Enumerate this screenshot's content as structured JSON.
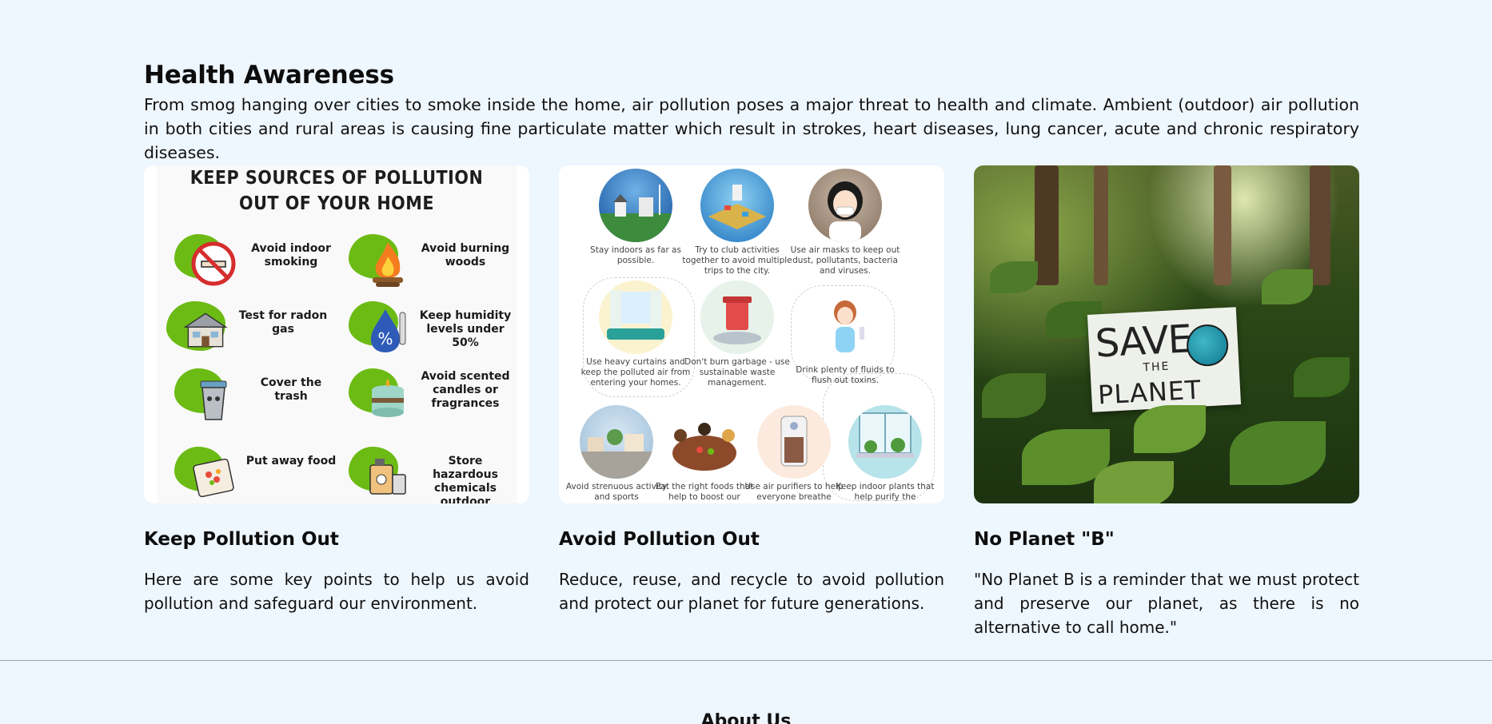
{
  "section": {
    "title": "Health Awareness",
    "intro": "From smog hanging over cities to smoke inside the home, air pollution poses a major threat to health and climate. Ambient (outdoor) air pollution in both cities and rural areas is causing fine particulate matter which result in strokes, heart diseases, lung cancer, acute and chronic respiratory diseases."
  },
  "cards": [
    {
      "title": "Keep Pollution Out",
      "text": "Here are some key points to help us avoid pollution and safeguard our environment.",
      "infographic": {
        "heading_line1": "KEEP SOURCES OF POLLUTION",
        "heading_line2": "OUT OF YOUR HOME",
        "tips": [
          {
            "label": "Avoid indoor smoking",
            "icon": "no-smoking-icon"
          },
          {
            "label": "Avoid burning woods",
            "icon": "fire-icon"
          },
          {
            "label": "Test for radon gas",
            "icon": "house-icon"
          },
          {
            "label": "Keep humidity levels under 50%",
            "icon": "humidity-icon"
          },
          {
            "label": "Cover the trash",
            "icon": "trash-can-icon"
          },
          {
            "label": "Avoid scented candles or fragrances",
            "icon": "candle-icon"
          },
          {
            "label": "Put away food",
            "icon": "food-plate-icon"
          },
          {
            "label": "Store hazardous chemicals outdoor",
            "icon": "chemical-bottle-icon"
          }
        ]
      }
    },
    {
      "title": "Avoid Pollution Out",
      "text": "Reduce, reuse, and recycle to avoid pollution and protect our planet for future generations.",
      "infographic": {
        "tips": [
          {
            "label": "Stay indoors as far as possible.",
            "icon": "city-icon"
          },
          {
            "label": "Try to club activities together to avoid multiple trips to the city.",
            "icon": "traffic-icon"
          },
          {
            "label": "Use air masks to keep out dust, pollutants, bacteria and viruses.",
            "icon": "mask-girl-icon"
          },
          {
            "label": "Use heavy curtains and keep the polluted air from entering your homes.",
            "icon": "curtains-icon"
          },
          {
            "label": "Don't burn garbage - use sustainable waste management.",
            "icon": "recycle-bin-icon"
          },
          {
            "label": "Drink plenty of fluids to flush out toxins.",
            "icon": "drinking-girl-icon"
          },
          {
            "label": "Avoid strenuous activity and sports",
            "icon": "neighborhood-icon"
          },
          {
            "label": "Eat the right foods that help to boost our",
            "icon": "family-dinner-icon"
          },
          {
            "label": "Use air purifiers to help everyone breathe",
            "icon": "air-purifier-icon"
          },
          {
            "label": "Keep indoor plants that help purify the",
            "icon": "window-plants-icon"
          }
        ]
      }
    },
    {
      "title": "No Planet \"B\"",
      "text": "\"No Planet B is a reminder that we must protect and preserve our planet, as there is no alternative to call home.\"",
      "photo": {
        "sign_line1": "SAVE",
        "sign_line2": "THE",
        "sign_line3": "PLANET"
      }
    }
  ],
  "footer": {
    "heading": "About Us"
  },
  "colors": {
    "page_background": "#eef6fe",
    "accent_green": "#6cbb14",
    "divider": "#9aa3ad"
  }
}
